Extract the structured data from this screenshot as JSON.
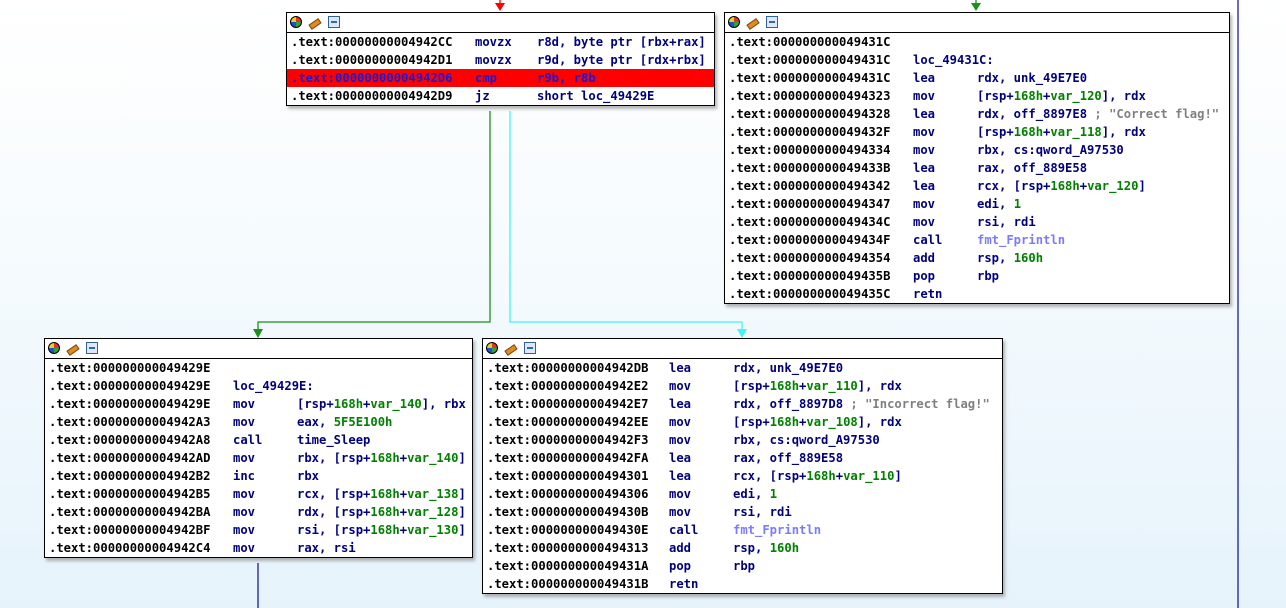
{
  "colors": {
    "edge_true": "#1d8f1d",
    "edge_false": "#44f4f4",
    "edge_default": "#1a1aa8",
    "edge_incoming_red": "#ff0000",
    "selected_line": "#ff0000",
    "mnemonic": "#00007f",
    "number": "#008000",
    "function_ref": "#7b7bff",
    "comment": "#808080"
  },
  "icons": [
    "color-picker-icon",
    "rename-node-icon",
    "group-nodes-icon"
  ],
  "nodes": [
    {
      "id": "block-cmp",
      "lines": [
        {
          "addr": ".text:00000000004942CC",
          "mn": "movzx",
          "op": "r8d, byte ptr [rbx+rax]"
        },
        {
          "addr": ".text:00000000004942D1",
          "mn": "movzx",
          "op": "r9d, byte ptr [rdx+rbx]"
        },
        {
          "addr": ".text:00000000004942D6",
          "mn": "cmp",
          "op": "r9b, r8b",
          "selected": true
        },
        {
          "addr": ".text:00000000004942D9",
          "mn": "jz",
          "op": "short loc_49429E"
        }
      ]
    },
    {
      "id": "block-correct",
      "lines": [
        {
          "addr": ".text:000000000049431C",
          "mn": "",
          "op": ""
        },
        {
          "addr": ".text:000000000049431C",
          "label": "loc_49431C:"
        },
        {
          "addr": ".text:000000000049431C",
          "mn": "lea",
          "op": "rdx, unk_49E7E0"
        },
        {
          "addr": ".text:0000000000494323",
          "mn": "mov",
          "op": "[rsp+168h+var_120], rdx"
        },
        {
          "addr": ".text:0000000000494328",
          "mn": "lea",
          "op": "rdx, off_8897E8",
          "cmt": "; \"Correct flag!\""
        },
        {
          "addr": ".text:000000000049432F",
          "mn": "mov",
          "op": "[rsp+168h+var_118], rdx"
        },
        {
          "addr": ".text:0000000000494334",
          "mn": "mov",
          "op": "rbx, cs:qword_A97530"
        },
        {
          "addr": ".text:000000000049433B",
          "mn": "lea",
          "op": "rax, off_889E58"
        },
        {
          "addr": ".text:0000000000494342",
          "mn": "lea",
          "op": "rcx, [rsp+168h+var_120]"
        },
        {
          "addr": ".text:0000000000494347",
          "mn": "mov",
          "op": "edi, 1"
        },
        {
          "addr": ".text:000000000049434C",
          "mn": "mov",
          "op": "rsi, rdi"
        },
        {
          "addr": ".text:000000000049434F",
          "mn": "call",
          "op": "fmt_Fprintln"
        },
        {
          "addr": ".text:0000000000494354",
          "mn": "add",
          "op": "rsp, 160h"
        },
        {
          "addr": ".text:000000000049435B",
          "mn": "pop",
          "op": "rbp"
        },
        {
          "addr": ".text:000000000049435C",
          "mn": "retn",
          "op": ""
        }
      ]
    },
    {
      "id": "block-loop",
      "lines": [
        {
          "addr": ".text:000000000049429E",
          "mn": "",
          "op": ""
        },
        {
          "addr": ".text:000000000049429E",
          "label": "loc_49429E:"
        },
        {
          "addr": ".text:000000000049429E",
          "mn": "mov",
          "op": "[rsp+168h+var_140], rbx"
        },
        {
          "addr": ".text:00000000004942A3",
          "mn": "mov",
          "op": "eax, 5F5E100h"
        },
        {
          "addr": ".text:00000000004942A8",
          "mn": "call",
          "op": "time_Sleep"
        },
        {
          "addr": ".text:00000000004942AD",
          "mn": "mov",
          "op": "rbx, [rsp+168h+var_140]"
        },
        {
          "addr": ".text:00000000004942B2",
          "mn": "inc",
          "op": "rbx"
        },
        {
          "addr": ".text:00000000004942B5",
          "mn": "mov",
          "op": "rcx, [rsp+168h+var_138]"
        },
        {
          "addr": ".text:00000000004942BA",
          "mn": "mov",
          "op": "rdx, [rsp+168h+var_128]"
        },
        {
          "addr": ".text:00000000004942BF",
          "mn": "mov",
          "op": "rsi, [rsp+168h+var_130]"
        },
        {
          "addr": ".text:00000000004942C4",
          "mn": "mov",
          "op": "rax, rsi"
        }
      ]
    },
    {
      "id": "block-incorrect",
      "lines": [
        {
          "addr": ".text:00000000004942DB",
          "mn": "lea",
          "op": "rdx, unk_49E7E0"
        },
        {
          "addr": ".text:00000000004942E2",
          "mn": "mov",
          "op": "[rsp+168h+var_110], rdx"
        },
        {
          "addr": ".text:00000000004942E7",
          "mn": "lea",
          "op": "rdx, off_8897D8",
          "cmt": "; \"Incorrect flag!\""
        },
        {
          "addr": ".text:00000000004942EE",
          "mn": "mov",
          "op": "[rsp+168h+var_108], rdx"
        },
        {
          "addr": ".text:00000000004942F3",
          "mn": "mov",
          "op": "rbx, cs:qword_A97530"
        },
        {
          "addr": ".text:00000000004942FA",
          "mn": "lea",
          "op": "rax, off_889E58"
        },
        {
          "addr": ".text:0000000000494301",
          "mn": "lea",
          "op": "rcx, [rsp+168h+var_110]"
        },
        {
          "addr": ".text:0000000000494306",
          "mn": "mov",
          "op": "edi, 1"
        },
        {
          "addr": ".text:000000000049430B",
          "mn": "mov",
          "op": "rsi, rdi"
        },
        {
          "addr": ".text:000000000049430E",
          "mn": "call",
          "op": "fmt_Fprintln"
        },
        {
          "addr": ".text:0000000000494313",
          "mn": "add",
          "op": "rsp, 160h"
        },
        {
          "addr": ".text:000000000049431A",
          "mn": "pop",
          "op": "rbp"
        },
        {
          "addr": ".text:000000000049431B",
          "mn": "retn",
          "op": ""
        }
      ]
    }
  ]
}
